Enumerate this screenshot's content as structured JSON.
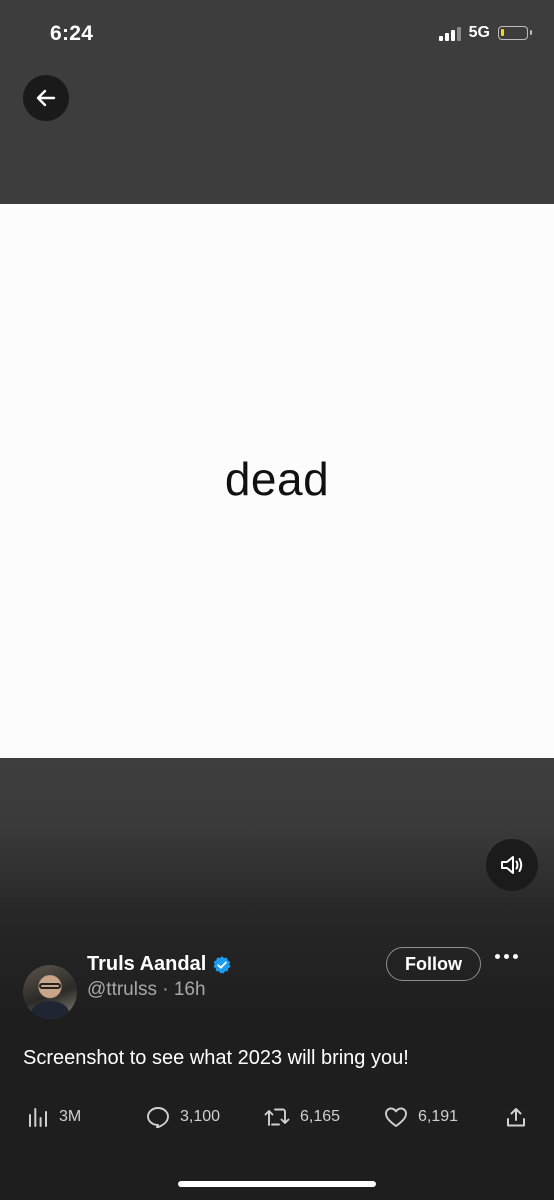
{
  "status_bar": {
    "time": "6:24",
    "network": "5G"
  },
  "media": {
    "text": "dead"
  },
  "tweet": {
    "author_name": "Truls Aandal",
    "handle": "@ttrulss",
    "time_ago": "· 16h",
    "follow_label": "Follow",
    "text": "Screenshot to see what 2023 will bring you!",
    "views": "3M",
    "replies": "3,100",
    "retweets": "6,165",
    "likes": "6,191"
  },
  "icons": [
    "back-arrow-icon",
    "speaker-icon",
    "verified-badge-icon",
    "more-icon",
    "views-icon",
    "reply-icon",
    "retweet-icon",
    "like-icon",
    "share-icon"
  ],
  "colors": {
    "verified": "#1d9bf0",
    "battery_level": "#ffd60a"
  }
}
